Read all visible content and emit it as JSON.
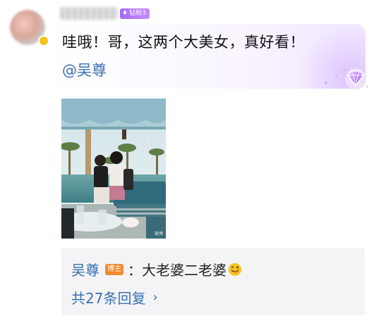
{
  "comment": {
    "fan_badge": "钻粉3",
    "text": "哇哦！哥，这两个大美女，真好看！",
    "mention": "@吴尊"
  },
  "reply": {
    "author": "吴尊",
    "badge": "博主",
    "text": "：大老婆二老婆",
    "emoji": "tongue-wink-emoji",
    "more": "共27条回复"
  },
  "colors": {
    "link": "#3a6fb0",
    "badge_purple": "#a56af2",
    "host_badge": "#f08a2e"
  }
}
